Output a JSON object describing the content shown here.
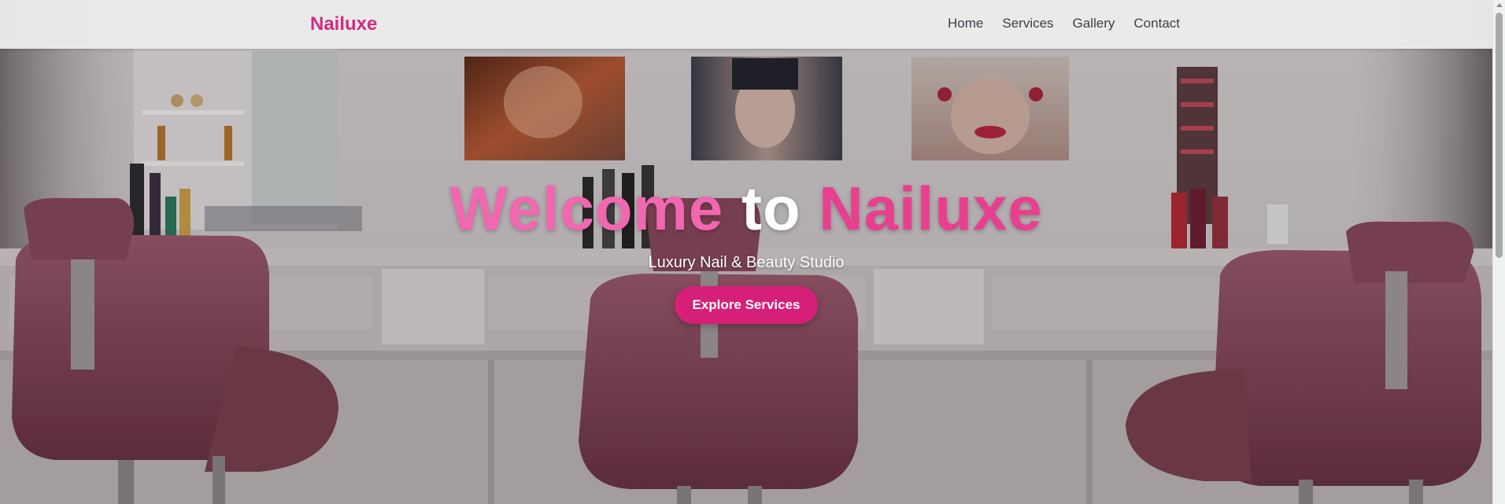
{
  "nav": {
    "brand": "Nailuxe",
    "links": [
      "Home",
      "Services",
      "Gallery",
      "Contact"
    ]
  },
  "hero": {
    "title_part1": "Welcome",
    "title_part2": "to",
    "title_part3": "Nailuxe",
    "subtitle": "Luxury Nail & Beauty Studio",
    "cta_label": "Explore Services"
  },
  "colors": {
    "brand": "#d42a7f",
    "cta_background": "#d61f77",
    "title_pink_light": "#f167b0",
    "title_pink": "#e93f8f",
    "chair": "#8a4a5d"
  },
  "icons": {
    "background_image": "salon-interior-illustration"
  }
}
